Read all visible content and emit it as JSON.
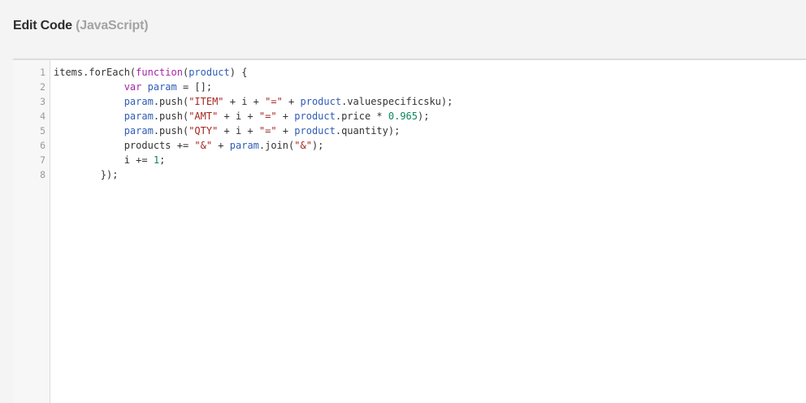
{
  "header": {
    "title": "Edit Code",
    "language": "(JavaScript)"
  },
  "editor": {
    "colors": {
      "keyword": "#a626a4",
      "variable": "#2f5db6",
      "string": "#a3261f",
      "number": "#098658",
      "plain": "#333333"
    },
    "lines": [
      {
        "number": "1",
        "tokens": [
          {
            "t": "plain",
            "v": "items.forEach("
          },
          {
            "t": "kw",
            "v": "function"
          },
          {
            "t": "plain",
            "v": "("
          },
          {
            "t": "var",
            "v": "product"
          },
          {
            "t": "plain",
            "v": ") {"
          }
        ]
      },
      {
        "number": "2",
        "tokens": [
          {
            "t": "plain",
            "v": "            "
          },
          {
            "t": "kw",
            "v": "var"
          },
          {
            "t": "plain",
            "v": " "
          },
          {
            "t": "var",
            "v": "param"
          },
          {
            "t": "plain",
            "v": " = [];"
          }
        ]
      },
      {
        "number": "3",
        "tokens": [
          {
            "t": "plain",
            "v": "            "
          },
          {
            "t": "var",
            "v": "param"
          },
          {
            "t": "plain",
            "v": ".push("
          },
          {
            "t": "str",
            "v": "\"ITEM\""
          },
          {
            "t": "plain",
            "v": " + i + "
          },
          {
            "t": "str",
            "v": "\"=\""
          },
          {
            "t": "plain",
            "v": " + "
          },
          {
            "t": "var",
            "v": "product"
          },
          {
            "t": "plain",
            "v": ".valuespecificsku);"
          }
        ]
      },
      {
        "number": "4",
        "tokens": [
          {
            "t": "plain",
            "v": "            "
          },
          {
            "t": "var",
            "v": "param"
          },
          {
            "t": "plain",
            "v": ".push("
          },
          {
            "t": "str",
            "v": "\"AMT\""
          },
          {
            "t": "plain",
            "v": " + i + "
          },
          {
            "t": "str",
            "v": "\"=\""
          },
          {
            "t": "plain",
            "v": " + "
          },
          {
            "t": "var",
            "v": "product"
          },
          {
            "t": "plain",
            "v": ".price * "
          },
          {
            "t": "num",
            "v": "0.965"
          },
          {
            "t": "plain",
            "v": ");"
          }
        ]
      },
      {
        "number": "5",
        "tokens": [
          {
            "t": "plain",
            "v": "            "
          },
          {
            "t": "var",
            "v": "param"
          },
          {
            "t": "plain",
            "v": ".push("
          },
          {
            "t": "str",
            "v": "\"QTY\""
          },
          {
            "t": "plain",
            "v": " + i + "
          },
          {
            "t": "str",
            "v": "\"=\""
          },
          {
            "t": "plain",
            "v": " + "
          },
          {
            "t": "var",
            "v": "product"
          },
          {
            "t": "plain",
            "v": ".quantity);"
          }
        ]
      },
      {
        "number": "6",
        "tokens": [
          {
            "t": "plain",
            "v": "            products += "
          },
          {
            "t": "str",
            "v": "\"&\""
          },
          {
            "t": "plain",
            "v": " + "
          },
          {
            "t": "var",
            "v": "param"
          },
          {
            "t": "plain",
            "v": ".join("
          },
          {
            "t": "str",
            "v": "\"&\""
          },
          {
            "t": "plain",
            "v": ");"
          }
        ]
      },
      {
        "number": "7",
        "tokens": [
          {
            "t": "plain",
            "v": "            i += "
          },
          {
            "t": "num",
            "v": "1"
          },
          {
            "t": "plain",
            "v": ";"
          }
        ]
      },
      {
        "number": "8",
        "tokens": [
          {
            "t": "plain",
            "v": "        });"
          }
        ]
      }
    ]
  }
}
